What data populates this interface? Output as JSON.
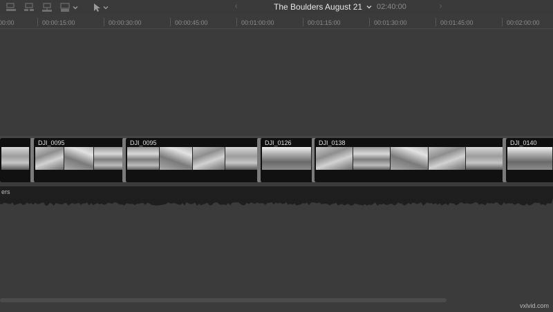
{
  "toolbar": {
    "tools": [
      {
        "icon": "append-clip-icon"
      },
      {
        "icon": "insert-clip-icon"
      },
      {
        "icon": "connect-clip-icon"
      },
      {
        "icon": "overwrite-clip-icon"
      },
      {
        "icon": "select-arrow-icon"
      }
    ],
    "prev_arrow": "‹",
    "next_arrow": "›",
    "project_title": "The Boulders August 21",
    "duration": "02:40:00"
  },
  "ruler": {
    "ticks": [
      "00:00",
      "00:00:15:00",
      "00:00:30:00",
      "00:00:45:00",
      "00:01:00:00",
      "00:01:15:00",
      "00:01:30:00",
      "00:01:45:00",
      "00:02:00:00"
    ]
  },
  "clips": [
    {
      "name": ""
    },
    {
      "name": "DJI_0095"
    },
    {
      "name": "DJI_0095"
    },
    {
      "name": "DJI_0126"
    },
    {
      "name": "DJI_0138"
    },
    {
      "name": "DJI_0140"
    }
  ],
  "audio": {
    "label": "ers"
  },
  "watermark": "vxlvid.com"
}
